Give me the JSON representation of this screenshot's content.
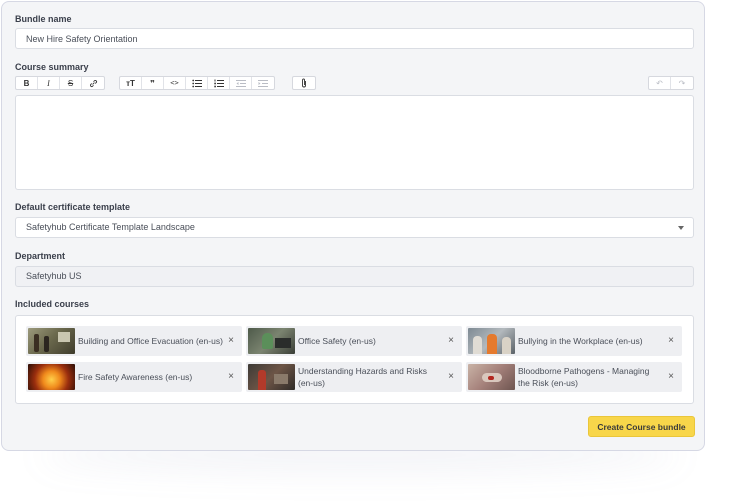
{
  "form": {
    "bundle_name_label": "Bundle name",
    "bundle_name_value": "New Hire Safety Orientation",
    "course_summary_label": "Course summary",
    "certificate_label": "Default certificate template",
    "certificate_value": "Safetyhub Certificate Template Landscape",
    "department_label": "Department",
    "department_value": "Safetyhub US",
    "included_courses_label": "Included courses",
    "submit_label": "Create Course bundle"
  },
  "toolbar": {
    "bold": "B",
    "italic": "I",
    "strike": "S",
    "link": "🔗",
    "heading": "тT",
    "quote": "❞",
    "code": "<>",
    "undo": "↶",
    "redo": "↷"
  },
  "courses": [
    {
      "label": "Building and Office Evacuation (en-us)",
      "remove": "×"
    },
    {
      "label": "Office Safety (en-us)",
      "remove": "×"
    },
    {
      "label": "Bullying in the Workplace (en-us)",
      "remove": "×"
    },
    {
      "label": "Fire Safety Awareness (en-us)",
      "remove": "×"
    },
    {
      "label": "Understanding Hazards and Risks (en-us)",
      "remove": "×"
    },
    {
      "label": "Bloodborne Pathogens - Managing the Risk (en-us)",
      "remove": "×"
    }
  ],
  "colors": {
    "accent_button": "#f8d64a",
    "card_background": "#f4f5f7"
  }
}
